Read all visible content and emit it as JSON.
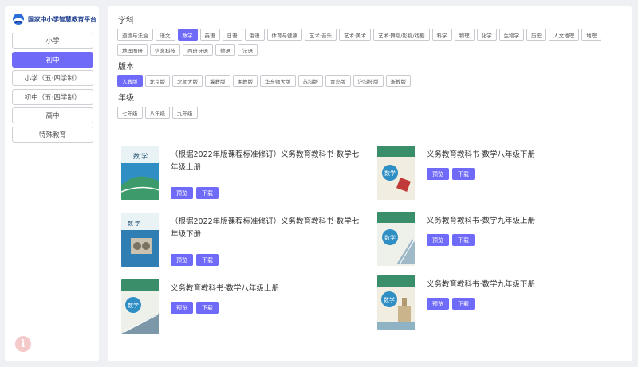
{
  "brand": {
    "name": "国家中小学智慧教育平台"
  },
  "sidebar": {
    "items": [
      {
        "label": "小学",
        "active": false
      },
      {
        "label": "初中",
        "active": true
      },
      {
        "label": "小学（五·四学制）",
        "active": false
      },
      {
        "label": "初中（五·四学制）",
        "active": false
      },
      {
        "label": "高中",
        "active": false
      },
      {
        "label": "特殊教育",
        "active": false
      }
    ],
    "info_icon": "i"
  },
  "filters": {
    "subject": {
      "label": "学科",
      "options": [
        {
          "label": "道德与法治",
          "active": false
        },
        {
          "label": "语文",
          "active": false
        },
        {
          "label": "数学",
          "active": true
        },
        {
          "label": "英语",
          "active": false
        },
        {
          "label": "日语",
          "active": false
        },
        {
          "label": "俄语",
          "active": false
        },
        {
          "label": "体育与健康",
          "active": false
        },
        {
          "label": "艺术·音乐",
          "active": false
        },
        {
          "label": "艺术·美术",
          "active": false
        },
        {
          "label": "艺术·舞蹈/影视/戏剧",
          "active": false
        },
        {
          "label": "科学",
          "active": false
        },
        {
          "label": "物理",
          "active": false
        },
        {
          "label": "化学",
          "active": false
        },
        {
          "label": "生物学",
          "active": false
        },
        {
          "label": "历史",
          "active": false
        },
        {
          "label": "人文地理",
          "active": false
        },
        {
          "label": "地理",
          "active": false
        },
        {
          "label": "地理图册",
          "active": false
        },
        {
          "label": "信息科技",
          "active": false
        },
        {
          "label": "西班牙语",
          "active": false
        },
        {
          "label": "德语",
          "active": false
        },
        {
          "label": "法语",
          "active": false
        }
      ]
    },
    "edition": {
      "label": "版本",
      "options": [
        {
          "label": "人教版",
          "active": true
        },
        {
          "label": "北京版",
          "active": false
        },
        {
          "label": "北师大版",
          "active": false
        },
        {
          "label": "冀教版",
          "active": false
        },
        {
          "label": "湘教版",
          "active": false
        },
        {
          "label": "华东师大版",
          "active": false
        },
        {
          "label": "苏科版",
          "active": false
        },
        {
          "label": "青岛版",
          "active": false
        },
        {
          "label": "沪科技版",
          "active": false
        },
        {
          "label": "浙教版",
          "active": false
        }
      ]
    },
    "grade": {
      "label": "年级",
      "options": [
        {
          "label": "七年级",
          "active": false
        },
        {
          "label": "八年级",
          "active": false
        },
        {
          "label": "九年级",
          "active": false
        }
      ]
    }
  },
  "actions": {
    "preview": "预览",
    "download": "下载"
  },
  "books": [
    {
      "title": "（根据2022年版课程标准修订）义务教育教科书·数学七年级上册",
      "cover_text": "数 学",
      "cover_color": "#2f8fc4"
    },
    {
      "title": "义务教育教科书·数学八年级下册",
      "cover_text": "数学",
      "cover_color": "#2f8fc4"
    },
    {
      "title": "（根据2022年版课程标准修订）义务教育教科书·数学七年级下册",
      "cover_text": "数 学",
      "cover_color": "#2f8fc4"
    },
    {
      "title": "义务教育教科书·数学九年级上册",
      "cover_text": "数学",
      "cover_color": "#2f8fc4"
    },
    {
      "title": "义务教育教科书·数学八年级上册",
      "cover_text": "数学",
      "cover_color": "#2f8fc4"
    },
    {
      "title": "义务教育教科书·数学九年级下册",
      "cover_text": "数学",
      "cover_color": "#2f8fc4"
    }
  ],
  "colors": {
    "accent": "#6f6af8",
    "logo": "#1f3f8f"
  },
  "icons": {
    "logo": "platform-logo-icon",
    "info": "info-icon"
  }
}
